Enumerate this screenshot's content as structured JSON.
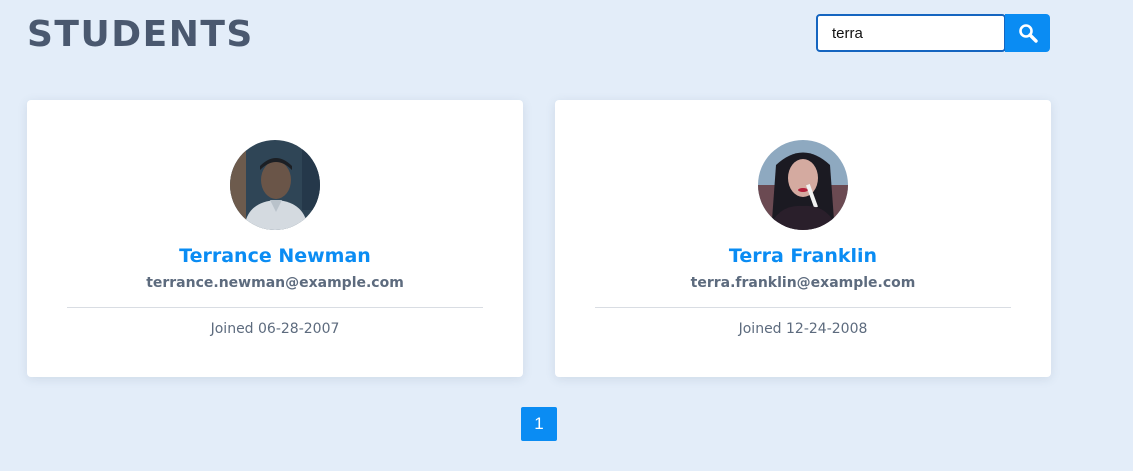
{
  "header": {
    "title": "STUDENTS"
  },
  "search": {
    "value": "terra",
    "icon": "search-icon"
  },
  "students": [
    {
      "name": "Terrance Newman",
      "email": "terrance.newman@example.com",
      "joined": "Joined 06-28-2007"
    },
    {
      "name": "Terra Franklin",
      "email": "terra.franklin@example.com",
      "joined": "Joined 12-24-2008"
    }
  ],
  "pagination": {
    "current": "1"
  },
  "colors": {
    "accent": "#0a8cf3",
    "background": "#e3edf9",
    "title": "#4a586f",
    "muted": "#5d6b7e"
  }
}
